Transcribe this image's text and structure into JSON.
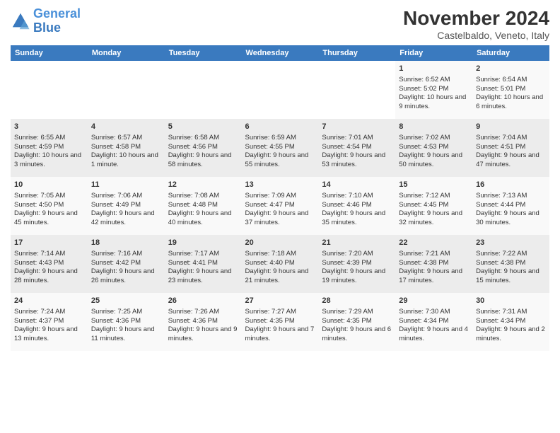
{
  "header": {
    "logo_line1": "General",
    "logo_line2": "Blue",
    "title": "November 2024",
    "subtitle": "Castelbaldo, Veneto, Italy"
  },
  "weekdays": [
    "Sunday",
    "Monday",
    "Tuesday",
    "Wednesday",
    "Thursday",
    "Friday",
    "Saturday"
  ],
  "weeks": [
    [
      {
        "day": "",
        "info": ""
      },
      {
        "day": "",
        "info": ""
      },
      {
        "day": "",
        "info": ""
      },
      {
        "day": "",
        "info": ""
      },
      {
        "day": "",
        "info": ""
      },
      {
        "day": "1",
        "info": "Sunrise: 6:52 AM\nSunset: 5:02 PM\nDaylight: 10 hours and 9 minutes."
      },
      {
        "day": "2",
        "info": "Sunrise: 6:54 AM\nSunset: 5:01 PM\nDaylight: 10 hours and 6 minutes."
      }
    ],
    [
      {
        "day": "3",
        "info": "Sunrise: 6:55 AM\nSunset: 4:59 PM\nDaylight: 10 hours and 3 minutes."
      },
      {
        "day": "4",
        "info": "Sunrise: 6:57 AM\nSunset: 4:58 PM\nDaylight: 10 hours and 1 minute."
      },
      {
        "day": "5",
        "info": "Sunrise: 6:58 AM\nSunset: 4:56 PM\nDaylight: 9 hours and 58 minutes."
      },
      {
        "day": "6",
        "info": "Sunrise: 6:59 AM\nSunset: 4:55 PM\nDaylight: 9 hours and 55 minutes."
      },
      {
        "day": "7",
        "info": "Sunrise: 7:01 AM\nSunset: 4:54 PM\nDaylight: 9 hours and 53 minutes."
      },
      {
        "day": "8",
        "info": "Sunrise: 7:02 AM\nSunset: 4:53 PM\nDaylight: 9 hours and 50 minutes."
      },
      {
        "day": "9",
        "info": "Sunrise: 7:04 AM\nSunset: 4:51 PM\nDaylight: 9 hours and 47 minutes."
      }
    ],
    [
      {
        "day": "10",
        "info": "Sunrise: 7:05 AM\nSunset: 4:50 PM\nDaylight: 9 hours and 45 minutes."
      },
      {
        "day": "11",
        "info": "Sunrise: 7:06 AM\nSunset: 4:49 PM\nDaylight: 9 hours and 42 minutes."
      },
      {
        "day": "12",
        "info": "Sunrise: 7:08 AM\nSunset: 4:48 PM\nDaylight: 9 hours and 40 minutes."
      },
      {
        "day": "13",
        "info": "Sunrise: 7:09 AM\nSunset: 4:47 PM\nDaylight: 9 hours and 37 minutes."
      },
      {
        "day": "14",
        "info": "Sunrise: 7:10 AM\nSunset: 4:46 PM\nDaylight: 9 hours and 35 minutes."
      },
      {
        "day": "15",
        "info": "Sunrise: 7:12 AM\nSunset: 4:45 PM\nDaylight: 9 hours and 32 minutes."
      },
      {
        "day": "16",
        "info": "Sunrise: 7:13 AM\nSunset: 4:44 PM\nDaylight: 9 hours and 30 minutes."
      }
    ],
    [
      {
        "day": "17",
        "info": "Sunrise: 7:14 AM\nSunset: 4:43 PM\nDaylight: 9 hours and 28 minutes."
      },
      {
        "day": "18",
        "info": "Sunrise: 7:16 AM\nSunset: 4:42 PM\nDaylight: 9 hours and 26 minutes."
      },
      {
        "day": "19",
        "info": "Sunrise: 7:17 AM\nSunset: 4:41 PM\nDaylight: 9 hours and 23 minutes."
      },
      {
        "day": "20",
        "info": "Sunrise: 7:18 AM\nSunset: 4:40 PM\nDaylight: 9 hours and 21 minutes."
      },
      {
        "day": "21",
        "info": "Sunrise: 7:20 AM\nSunset: 4:39 PM\nDaylight: 9 hours and 19 minutes."
      },
      {
        "day": "22",
        "info": "Sunrise: 7:21 AM\nSunset: 4:38 PM\nDaylight: 9 hours and 17 minutes."
      },
      {
        "day": "23",
        "info": "Sunrise: 7:22 AM\nSunset: 4:38 PM\nDaylight: 9 hours and 15 minutes."
      }
    ],
    [
      {
        "day": "24",
        "info": "Sunrise: 7:24 AM\nSunset: 4:37 PM\nDaylight: 9 hours and 13 minutes."
      },
      {
        "day": "25",
        "info": "Sunrise: 7:25 AM\nSunset: 4:36 PM\nDaylight: 9 hours and 11 minutes."
      },
      {
        "day": "26",
        "info": "Sunrise: 7:26 AM\nSunset: 4:36 PM\nDaylight: 9 hours and 9 minutes."
      },
      {
        "day": "27",
        "info": "Sunrise: 7:27 AM\nSunset: 4:35 PM\nDaylight: 9 hours and 7 minutes."
      },
      {
        "day": "28",
        "info": "Sunrise: 7:29 AM\nSunset: 4:35 PM\nDaylight: 9 hours and 6 minutes."
      },
      {
        "day": "29",
        "info": "Sunrise: 7:30 AM\nSunset: 4:34 PM\nDaylight: 9 hours and 4 minutes."
      },
      {
        "day": "30",
        "info": "Sunrise: 7:31 AM\nSunset: 4:34 PM\nDaylight: 9 hours and 2 minutes."
      }
    ]
  ]
}
